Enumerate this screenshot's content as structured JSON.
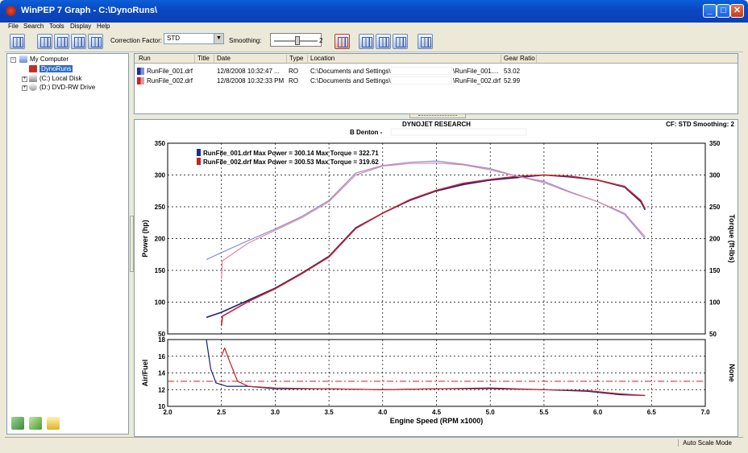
{
  "window": {
    "title": "WinPEP 7   Graph - C:\\DynoRuns\\",
    "controls": [
      "minimize",
      "maximize",
      "close"
    ]
  },
  "menu": [
    "File",
    "Search",
    "Tools",
    "Display",
    "Help"
  ],
  "toolbar": {
    "correction_label": "Correction Factor:",
    "correction_value": "STD",
    "smoothing_label": "Smoothing:",
    "smoothing_value": "2"
  },
  "tree": {
    "root": "My Computer",
    "items": [
      {
        "label": "DynoRuns",
        "selected": true
      },
      {
        "label": "(C:) Local Disk",
        "selected": false
      },
      {
        "label": "(D:) DVD-RW Drive",
        "selected": false
      }
    ]
  },
  "runs_table": {
    "headers": [
      "Run",
      "Title",
      "Date",
      "Type",
      "Location",
      "Gear Ratio"
    ],
    "rows": [
      {
        "run": "RunFile_001.drf",
        "title": "",
        "date": "12/8/2008 10:32:47 ...",
        "type": "RO",
        "location": "C:\\Documents and Settings\\",
        "location_tail": "\\RunFile_001....",
        "gear_ratio": "53.02",
        "color": "#1a2f9e"
      },
      {
        "run": "RunFile_002.drf",
        "title": "",
        "date": "12/8/2008 10:32:33 PM",
        "type": "RO",
        "location": "C:\\Documents and Settings\\",
        "location_tail": "\\RunFile_002.drf",
        "gear_ratio": "52.99",
        "color": "#c8202a"
      }
    ]
  },
  "graph_header": {
    "company": "DYNOJET RESEARCH",
    "customer": "B Denton -",
    "cf_text": "CF: STD  Smoothing: 2"
  },
  "chart_data": [
    {
      "type": "line",
      "xlabel": "Engine Speed (RPM x1000)",
      "ylabel": "Power (hp)",
      "ylabel_right": "Torque (ft-lbs)",
      "xlim": [
        2.0,
        7.0
      ],
      "ylim": [
        50,
        350
      ],
      "x_ticks": [
        "2.0",
        "2.5",
        "3.0",
        "3.5",
        "4.0",
        "4.5",
        "5.0",
        "5.5",
        "6.0",
        "6.5",
        "7.0"
      ],
      "y_ticks": [
        "50",
        "100",
        "150",
        "200",
        "250",
        "300",
        "350"
      ],
      "grid": true,
      "legend": [
        {
          "text": "RunFile_001.drf Max Power = 300.14 Max Torque = 322.71",
          "color": "#1a2f9e"
        },
        {
          "text": "RunFile_002.drf Max Power = 300.53 Max Torque = 319.62",
          "color": "#c8202a"
        }
      ],
      "series": [
        {
          "kind": "power",
          "color": "#14207a",
          "x": [
            2.36,
            2.5,
            2.75,
            3.0,
            3.25,
            3.5,
            3.75,
            4.0,
            4.25,
            4.5,
            4.75,
            5.0,
            5.25,
            5.5,
            5.75,
            6.0,
            6.25,
            6.4,
            6.44
          ],
          "y": [
            76,
            84,
            103,
            122,
            146,
            172,
            217,
            240,
            260,
            275,
            285,
            292,
            296,
            300,
            297,
            292,
            281,
            258,
            245
          ]
        },
        {
          "kind": "power",
          "color": "#c8202a",
          "x": [
            2.5,
            2.51,
            2.75,
            3.0,
            3.25,
            3.5,
            3.75,
            4.0,
            4.25,
            4.5,
            4.75,
            5.0,
            5.25,
            5.5,
            5.75,
            6.0,
            6.25,
            6.4,
            6.44
          ],
          "y": [
            63,
            78,
            101,
            121,
            145,
            171,
            216,
            240,
            261,
            276,
            287,
            293,
            298,
            300,
            298,
            292,
            282,
            260,
            247
          ]
        },
        {
          "kind": "torque",
          "color": "#8a8ed8",
          "x": [
            2.36,
            2.5,
            2.75,
            3.0,
            3.25,
            3.5,
            3.75,
            4.0,
            4.25,
            4.5,
            4.75,
            5.0,
            5.25,
            5.5,
            5.75,
            6.0,
            6.25,
            6.44
          ],
          "y": [
            167,
            178,
            197,
            215,
            235,
            260,
            303,
            315,
            320,
            322,
            317,
            310,
            298,
            290,
            273,
            258,
            238,
            200
          ]
        },
        {
          "kind": "torque",
          "color": "#e08aa0",
          "x": [
            2.5,
            2.51,
            2.75,
            3.0,
            3.25,
            3.5,
            3.75,
            4.0,
            4.25,
            4.5,
            4.75,
            5.0,
            5.25,
            5.5,
            5.75,
            6.0,
            6.25,
            6.44
          ],
          "y": [
            136,
            165,
            193,
            213,
            233,
            258,
            300,
            314,
            318,
            319,
            316,
            308,
            298,
            288,
            272,
            258,
            240,
            203
          ]
        }
      ]
    },
    {
      "type": "line",
      "xlabel": "Engine Speed (RPM x1000)",
      "ylabel": "Air/Fuel",
      "ylabel_right": "None",
      "xlim": [
        2.0,
        7.0
      ],
      "ylim": [
        10,
        18
      ],
      "y_ticks": [
        "10",
        "12",
        "14",
        "16",
        "18"
      ],
      "grid": true,
      "reference_line": {
        "y": 13.0,
        "color": "#c8202a",
        "style": "dash-dot"
      },
      "series": [
        {
          "kind": "afr",
          "color": "#14207a",
          "x": [
            2.36,
            2.4,
            2.45,
            2.55,
            2.75,
            3.0,
            3.5,
            4.0,
            4.5,
            5.0,
            5.5,
            5.9,
            6.2,
            6.44
          ],
          "y": [
            18,
            14.5,
            12.8,
            12.4,
            12.4,
            12.1,
            12.1,
            12.0,
            12.1,
            12.2,
            12.0,
            11.8,
            11.4,
            11.3
          ]
        },
        {
          "kind": "afr",
          "color": "#c8202a",
          "x": [
            2.5,
            2.53,
            2.57,
            2.65,
            2.75,
            3.0,
            3.5,
            4.0,
            4.5,
            5.0,
            5.5,
            5.9,
            6.2,
            6.44
          ],
          "y": [
            16.0,
            17.0,
            15.6,
            13.0,
            12.4,
            12.2,
            12.1,
            12.0,
            12.1,
            12.1,
            12.0,
            11.9,
            11.5,
            11.3
          ]
        }
      ]
    }
  ],
  "status": {
    "mode": "Auto Scale Mode"
  }
}
